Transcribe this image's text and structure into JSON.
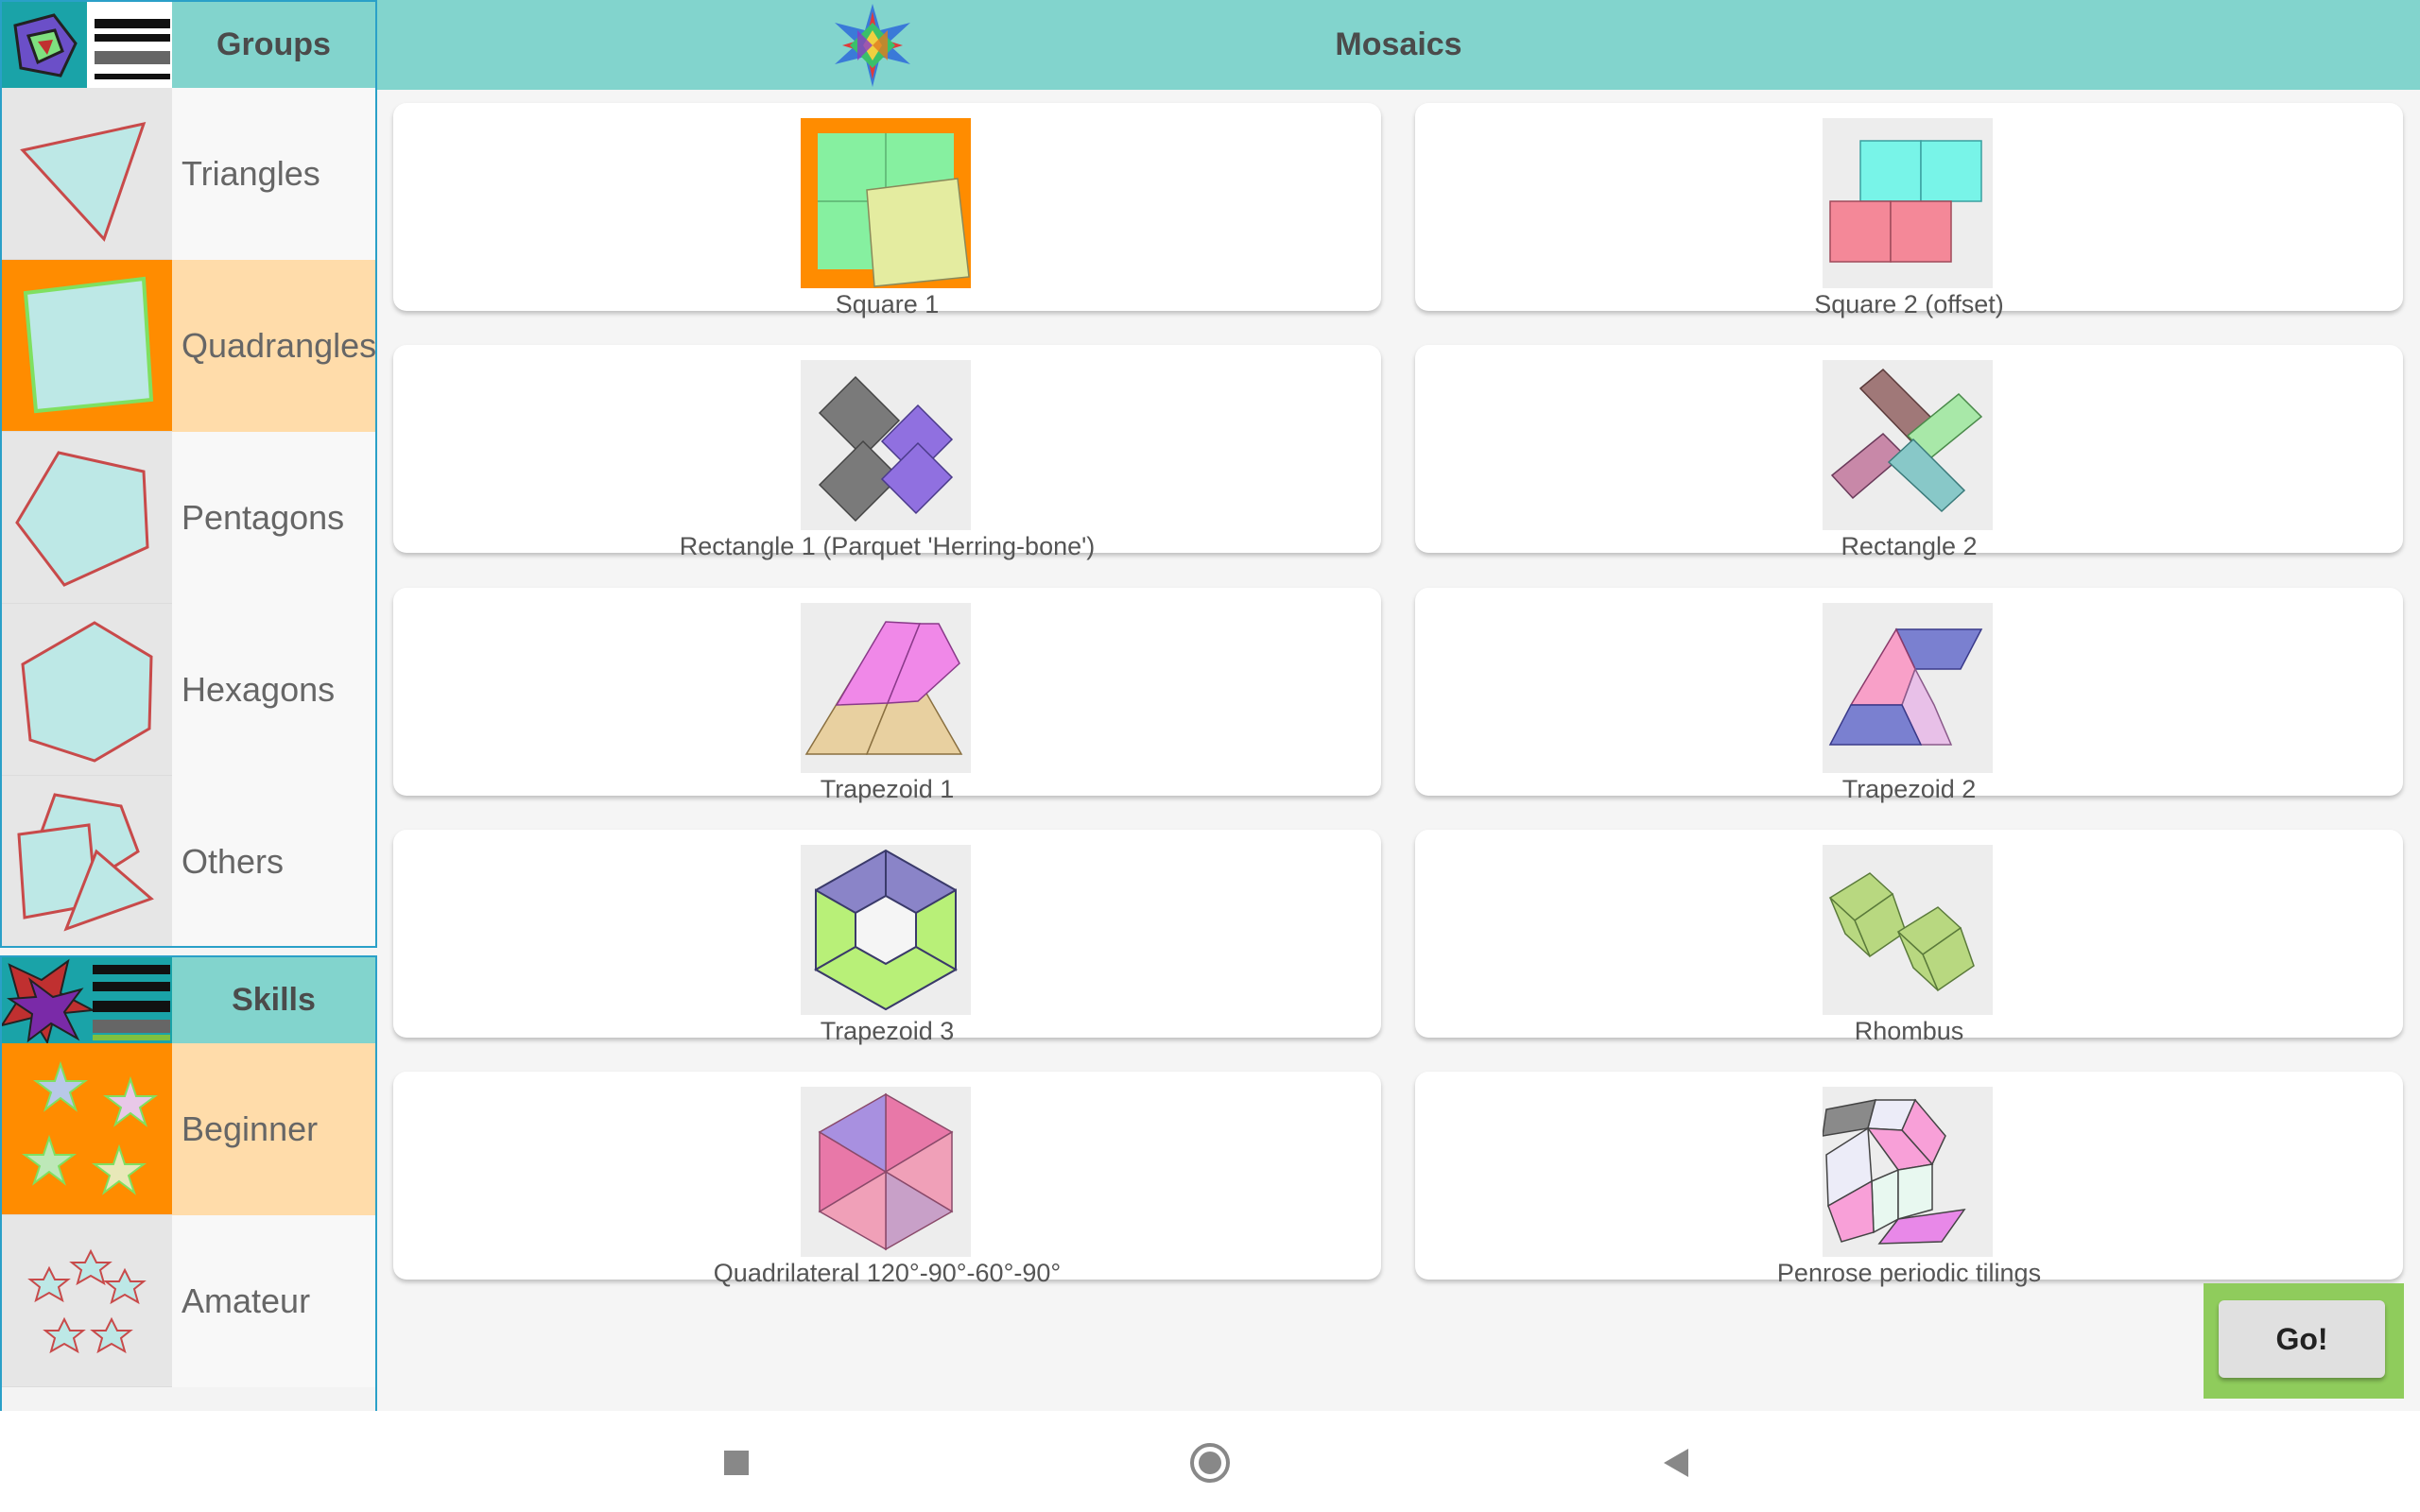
{
  "sidebar": {
    "groups": {
      "title": "Groups",
      "items": [
        {
          "label": "Triangles",
          "selected": false
        },
        {
          "label": "Quadrangles",
          "selected": true
        },
        {
          "label": "Pentagons",
          "selected": false
        },
        {
          "label": "Hexagons",
          "selected": false
        },
        {
          "label": "Others",
          "selected": false
        }
      ]
    },
    "skills": {
      "title": "Skills",
      "items": [
        {
          "label": "Beginner",
          "selected": true
        },
        {
          "label": "Amateur",
          "selected": false
        }
      ]
    }
  },
  "header": {
    "title": "Mosaics"
  },
  "mosaics": [
    {
      "label": "Square 1",
      "selected": true
    },
    {
      "label": "Square 2 (offset)",
      "selected": false
    },
    {
      "label": "Rectangle 1 (Parquet 'Herring-bone')",
      "selected": false
    },
    {
      "label": "Rectangle 2",
      "selected": false
    },
    {
      "label": "Trapezoid 1",
      "selected": false
    },
    {
      "label": "Trapezoid 2",
      "selected": false
    },
    {
      "label": "Trapezoid 3",
      "selected": false
    },
    {
      "label": "Rhombus",
      "selected": false
    },
    {
      "label": "Quadrilateral 120°-90°-60°-90°",
      "selected": false
    },
    {
      "label": "Penrose periodic tilings",
      "selected": false
    }
  ],
  "go_button": {
    "label": "Go!"
  },
  "colors": {
    "header_teal": "#82d4cd",
    "selection_orange": "#ff8c00",
    "selection_light": "#ffdcaa",
    "go_green": "#8fcc5c",
    "panel_border": "#2aa0c8"
  },
  "navbar": {
    "icons": [
      "recents-square-icon",
      "home-circle-icon",
      "back-triangle-icon"
    ]
  }
}
